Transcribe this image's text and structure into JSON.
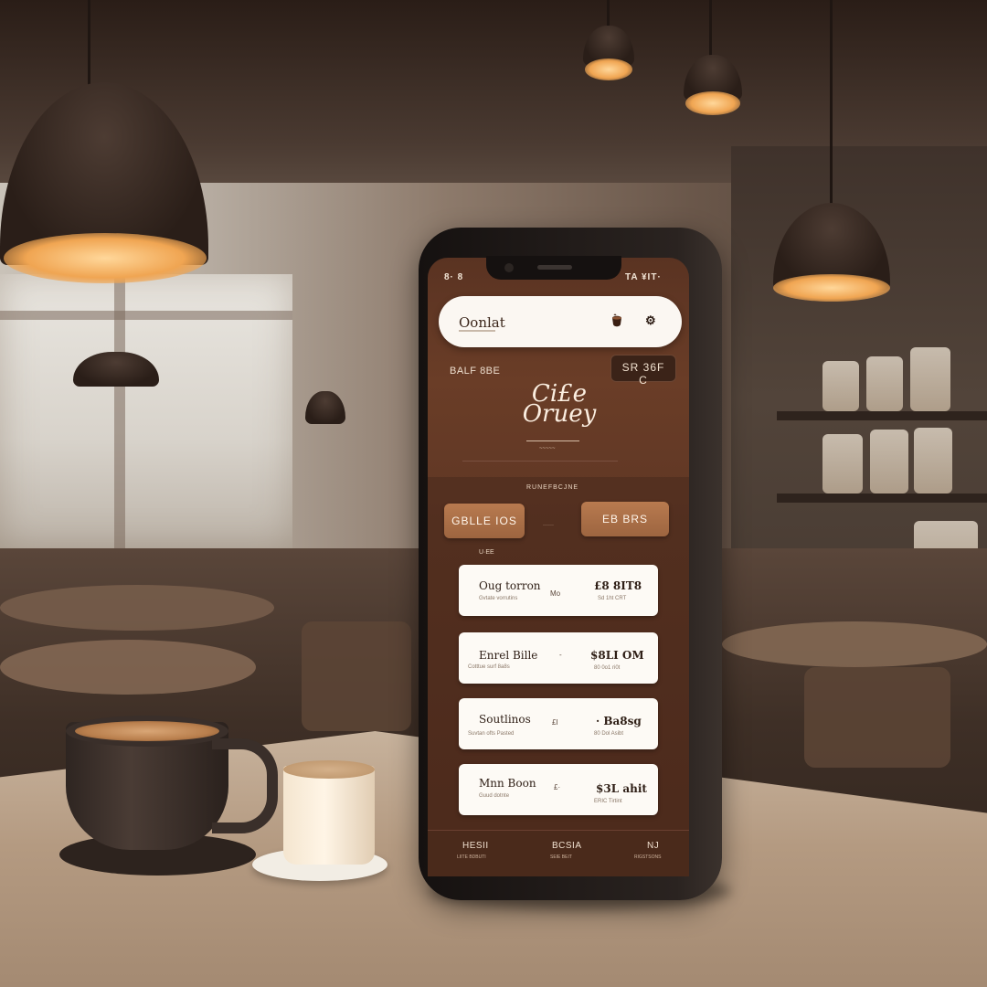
{
  "status_bar": {
    "left": "8· 8",
    "right": "TA ¥IT·"
  },
  "search": {
    "text": "Oonlat",
    "coffee_icon": "coffee-cup-icon",
    "settings_icon": "gear-icon",
    "settings_glyph": "⚙"
  },
  "hero": {
    "left_text": "BALF 8BE",
    "price_chip": "SR 36F C",
    "logo_line1": "Ci£e",
    "logo_line2": "Oruey",
    "logo_sub": "~~~~~"
  },
  "actions": {
    "section_label": "RUNEFBCJNE",
    "buttons": [
      {
        "label": "GBLLE IOS"
      },
      {
        "label": "EB BRS"
      }
    ],
    "middle_text": "······"
  },
  "list_label": "U·EE",
  "menu_items": [
    {
      "name": "Oug torron",
      "desc": "Gvtate vorrutins",
      "mid": "Mo",
      "price": "£8 8IT8",
      "price_sub": "Sd 1ht CRT"
    },
    {
      "name": "Enrel Bille",
      "desc": "Cotttue surf 8a8s",
      "mid": "-",
      "price": "$8LI OM",
      "price_sub": "80 0o1 ri0t"
    },
    {
      "name": "Soutlinos",
      "desc": "Suvtan ofts Pasted",
      "mid": "£I",
      "price": "· Ba8sg",
      "price_sub": "80 Dol Asibt"
    },
    {
      "name": "Mnn Boon",
      "desc": "Guud dotnte",
      "mid": "£·",
      "price": "$3L ahit",
      "price_sub": "ERIC Tirtint"
    }
  ],
  "bottom_nav": [
    {
      "label": "HESII",
      "sub": "LIITE BDBUTI"
    },
    {
      "label": "BCSIA",
      "sub": "SEIE BEIT"
    },
    {
      "label": "NJ",
      "sub": "RIGSTSONS"
    }
  ],
  "colors": {
    "screen_brown": "#5e3624",
    "accent_copper": "#b87a4f",
    "card_cream": "#fdfaf5"
  }
}
